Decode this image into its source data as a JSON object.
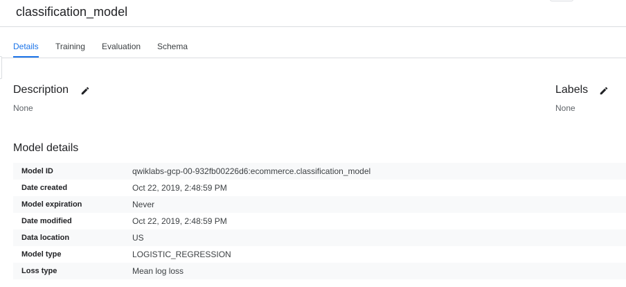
{
  "header": {
    "title": "classification_model"
  },
  "tabs": [
    {
      "label": "Details",
      "active": true
    },
    {
      "label": "Training",
      "active": false
    },
    {
      "label": "Evaluation",
      "active": false
    },
    {
      "label": "Schema",
      "active": false
    }
  ],
  "description": {
    "heading": "Description",
    "value": "None"
  },
  "labels": {
    "heading": "Labels",
    "value": "None"
  },
  "model_details": {
    "heading": "Model details",
    "rows": [
      {
        "key": "Model ID",
        "value": "qwiklabs-gcp-00-932fb00226d6:ecommerce.classification_model"
      },
      {
        "key": "Date created",
        "value": "Oct 22, 2019, 2:48:59 PM"
      },
      {
        "key": "Model expiration",
        "value": "Never"
      },
      {
        "key": "Date modified",
        "value": "Oct 22, 2019, 2:48:59 PM"
      },
      {
        "key": "Data location",
        "value": "US"
      },
      {
        "key": "Model type",
        "value": "LOGISTIC_REGRESSION"
      },
      {
        "key": "Loss type",
        "value": "Mean log loss"
      }
    ]
  },
  "colors": {
    "accent": "#1a73e8",
    "divider": "#dadce0",
    "row_shade": "#f8f9fa"
  },
  "icons": {
    "edit_description": "edit-pencil-icon",
    "edit_labels": "edit-pencil-icon"
  }
}
